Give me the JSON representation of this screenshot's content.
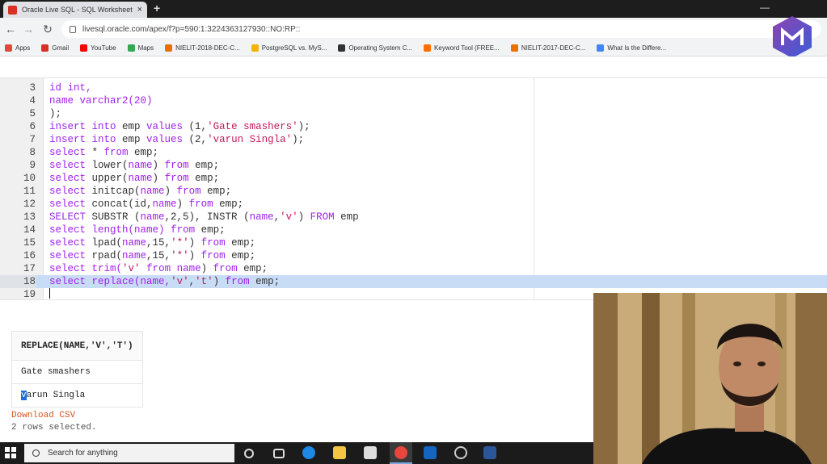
{
  "browser": {
    "tab_title": "Oracle Live SQL - SQL Worksheet",
    "tab_close": "×",
    "new_tab": "+",
    "url": "livesql.oracle.com/apex/f?p=590:1:3224363127930::NO:RP::",
    "bookmarks": [
      {
        "label": "Apps",
        "color": "#e8453c"
      },
      {
        "label": "Gmail",
        "color": "#d93025"
      },
      {
        "label": "YouTube",
        "color": "#ff0000"
      },
      {
        "label": "Maps",
        "color": "#34a853"
      },
      {
        "label": "NIELIT-2018-DEC-C...",
        "color": "#e37400"
      },
      {
        "label": "PostgreSQL vs. MyS...",
        "color": "#f4b400"
      },
      {
        "label": "Operating System C...",
        "color": "#333333"
      },
      {
        "label": "Keyword Tool (FREE...",
        "color": "#ff6d00"
      },
      {
        "label": "NIELIT-2017-DEC-C...",
        "color": "#e37400"
      },
      {
        "label": "What Is the Differe...",
        "color": "#4285f4"
      }
    ]
  },
  "editor": {
    "lines": [
      {
        "n": "3",
        "segs": [
          {
            "t": "id int,",
            "c": "kw"
          }
        ]
      },
      {
        "n": "4",
        "segs": [
          {
            "t": "name varchar2(20)",
            "c": "kw"
          }
        ]
      },
      {
        "n": "5",
        "segs": [
          {
            "t": ");",
            "c": "fn"
          }
        ]
      },
      {
        "n": "6",
        "segs": [
          {
            "t": "insert into",
            "c": "kw"
          },
          {
            "t": " emp ",
            "c": "fn"
          },
          {
            "t": "values",
            "c": "kw"
          },
          {
            "t": " (1,",
            "c": "fn"
          },
          {
            "t": "'Gate smashers'",
            "c": "str"
          },
          {
            "t": ");",
            "c": "fn"
          }
        ]
      },
      {
        "n": "7",
        "segs": [
          {
            "t": "insert into",
            "c": "kw"
          },
          {
            "t": " emp ",
            "c": "fn"
          },
          {
            "t": "values",
            "c": "kw"
          },
          {
            "t": " (2,",
            "c": "fn"
          },
          {
            "t": "'varun Singla'",
            "c": "str"
          },
          {
            "t": ");",
            "c": "fn"
          }
        ]
      },
      {
        "n": "8",
        "segs": [
          {
            "t": "select",
            "c": "kw"
          },
          {
            "t": " * ",
            "c": "fn"
          },
          {
            "t": "from",
            "c": "kw"
          },
          {
            "t": " emp;",
            "c": "fn"
          }
        ]
      },
      {
        "n": "9",
        "segs": [
          {
            "t": "select",
            "c": "kw"
          },
          {
            "t": " lower(",
            "c": "fn"
          },
          {
            "t": "name",
            "c": "kw"
          },
          {
            "t": ") ",
            "c": "fn"
          },
          {
            "t": "from",
            "c": "kw"
          },
          {
            "t": " emp;",
            "c": "fn"
          }
        ]
      },
      {
        "n": "10",
        "segs": [
          {
            "t": "select",
            "c": "kw"
          },
          {
            "t": " upper(",
            "c": "fn"
          },
          {
            "t": "name",
            "c": "kw"
          },
          {
            "t": ") ",
            "c": "fn"
          },
          {
            "t": "from",
            "c": "kw"
          },
          {
            "t": " emp;",
            "c": "fn"
          }
        ]
      },
      {
        "n": "11",
        "segs": [
          {
            "t": "select",
            "c": "kw"
          },
          {
            "t": " initcap(",
            "c": "fn"
          },
          {
            "t": "name",
            "c": "kw"
          },
          {
            "t": ") ",
            "c": "fn"
          },
          {
            "t": "from",
            "c": "kw"
          },
          {
            "t": " emp;",
            "c": "fn"
          }
        ]
      },
      {
        "n": "12",
        "segs": [
          {
            "t": "select",
            "c": "kw"
          },
          {
            "t": " concat(id,",
            "c": "fn"
          },
          {
            "t": "name",
            "c": "kw"
          },
          {
            "t": ") ",
            "c": "fn"
          },
          {
            "t": "from",
            "c": "kw"
          },
          {
            "t": " emp;",
            "c": "fn"
          }
        ]
      },
      {
        "n": "13",
        "segs": [
          {
            "t": "SELECT",
            "c": "kw"
          },
          {
            "t": " SUBSTR (",
            "c": "fn"
          },
          {
            "t": "name",
            "c": "kw"
          },
          {
            "t": ",2,5), INSTR (",
            "c": "fn"
          },
          {
            "t": "name",
            "c": "kw"
          },
          {
            "t": ",",
            "c": "fn"
          },
          {
            "t": "'v'",
            "c": "str"
          },
          {
            "t": ") ",
            "c": "fn"
          },
          {
            "t": "FROM",
            "c": "kw"
          },
          {
            "t": " emp",
            "c": "fn"
          }
        ]
      },
      {
        "n": "14",
        "segs": [
          {
            "t": "select",
            "c": "kw"
          },
          {
            "t": " ",
            "c": "fn"
          },
          {
            "t": "length(name)",
            "c": "kw"
          },
          {
            "t": " ",
            "c": "fn"
          },
          {
            "t": "from",
            "c": "kw"
          },
          {
            "t": " emp;",
            "c": "fn"
          }
        ]
      },
      {
        "n": "15",
        "segs": [
          {
            "t": "select",
            "c": "kw"
          },
          {
            "t": " lpad(",
            "c": "fn"
          },
          {
            "t": "name",
            "c": "kw"
          },
          {
            "t": ",15,",
            "c": "fn"
          },
          {
            "t": "'*'",
            "c": "str"
          },
          {
            "t": ") ",
            "c": "fn"
          },
          {
            "t": "from",
            "c": "kw"
          },
          {
            "t": " emp;",
            "c": "fn"
          }
        ]
      },
      {
        "n": "16",
        "segs": [
          {
            "t": "select",
            "c": "kw"
          },
          {
            "t": " rpad(",
            "c": "fn"
          },
          {
            "t": "name",
            "c": "kw"
          },
          {
            "t": ",15,",
            "c": "fn"
          },
          {
            "t": "'*'",
            "c": "str"
          },
          {
            "t": ") ",
            "c": "fn"
          },
          {
            "t": "from",
            "c": "kw"
          },
          {
            "t": " emp;",
            "c": "fn"
          }
        ]
      },
      {
        "n": "17",
        "segs": [
          {
            "t": "select",
            "c": "kw"
          },
          {
            "t": " ",
            "c": "fn"
          },
          {
            "t": "trim(",
            "c": "kw"
          },
          {
            "t": "'v'",
            "c": "str"
          },
          {
            "t": " ",
            "c": "fn"
          },
          {
            "t": "from name",
            "c": "kw"
          },
          {
            "t": ") ",
            "c": "fn"
          },
          {
            "t": "from",
            "c": "kw"
          },
          {
            "t": " emp;",
            "c": "fn"
          }
        ]
      },
      {
        "n": "18",
        "segs": [
          {
            "t": "select",
            "c": "kw"
          },
          {
            "t": " ",
            "c": "fn"
          },
          {
            "t": "replace(name,",
            "c": "kw"
          },
          {
            "t": "'v'",
            "c": "str"
          },
          {
            "t": ",",
            "c": "fn"
          },
          {
            "t": "'t'",
            "c": "str"
          },
          {
            "t": ") ",
            "c": "fn"
          },
          {
            "t": "from",
            "c": "kw"
          },
          {
            "t": " emp;",
            "c": "fn"
          }
        ]
      },
      {
        "n": "19",
        "segs": []
      }
    ],
    "highlighted_line": "18",
    "colors": {
      "keyword": "#a020f0",
      "string": "#c2185b",
      "highlight": "#c8dcf5"
    }
  },
  "results": {
    "column_header": "REPLACE(NAME,'V','T')",
    "rows": [
      {
        "value": "Gate smashers"
      },
      {
        "first_char": "v",
        "rest": "arun Singla"
      }
    ],
    "download_label": "Download CSV",
    "rows_selected": "2 rows selected."
  },
  "taskbar": {
    "search_placeholder": "Search for anything"
  }
}
